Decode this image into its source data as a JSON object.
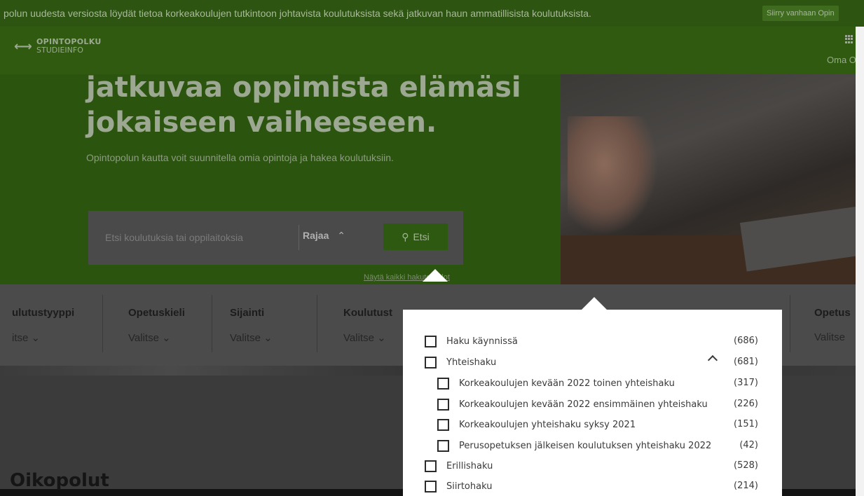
{
  "banner": {
    "text": "polun uudesta versiosta löydät tietoa korkeakoulujen tutkintoon johtavista koulutuksista sekä jatkuvan haun ammatillisista koulutuksista.",
    "old_version_button": "Siirry vanhaan Opin"
  },
  "header": {
    "logo_title": "OPINTOPOLKU",
    "logo_subtitle": "STUDIEINFO",
    "apps_icon": "apps-grid-icon",
    "oma": "Oma Opin"
  },
  "hero": {
    "title_line1": "jatkuvaa oppimista elämäsi",
    "title_line2": "jokaiseen vaiheeseen.",
    "lead": "Opintopolun kautta voit suunnitella omia opintoja ja hakea koulutuksiin.",
    "search_placeholder": "Etsi koulutuksia tai oppilaitoksia",
    "rajaa": "Rajaa",
    "etsi": "Etsi",
    "nayta": "Näytä kaikki hakutoehdot"
  },
  "filters": [
    {
      "label": "ulutustyyppi",
      "value": "itse"
    },
    {
      "label": "Opetuskieli",
      "value": "Valitse"
    },
    {
      "label": "Sijainti",
      "value": "Valitse"
    },
    {
      "label": "Koulutust",
      "value": "Valitse"
    },
    {
      "label": "Opetus",
      "value": "Valitse"
    }
  ],
  "dropdown": {
    "options": [
      {
        "label": "Haku käynnissä",
        "count": "(686)"
      },
      {
        "label": "Yhteishaku",
        "count": "(681)"
      },
      {
        "label": "Korkeakoulujen kevään 2022 toinen yhteishaku",
        "count": "(317)"
      },
      {
        "label": "Korkeakoulujen kevään 2022 ensimmäinen yhteishaku",
        "count": "(226)"
      },
      {
        "label": "Korkeakoulujen yhteishaku syksy 2021",
        "count": "(151)"
      },
      {
        "label": "Perusopetuksen jälkeisen koulutuksen yhteishaku 2022",
        "count": "(42)"
      },
      {
        "label": "Erillishaku",
        "count": "(528)"
      },
      {
        "label": "Siirtohaku",
        "count": "(214)"
      }
    ]
  },
  "lower": {
    "heading": "Oikopolut"
  }
}
